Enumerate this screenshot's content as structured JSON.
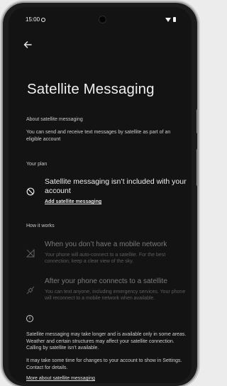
{
  "status_bar": {
    "time": "15:00"
  },
  "page": {
    "title": "Satellite Messaging"
  },
  "about": {
    "heading": "About satellite messaging",
    "text": "You can send and receive text messages by satellite as part of an eligible  account"
  },
  "plan": {
    "heading": "Your plan",
    "title": "Satellite messaging isn’t included with your account",
    "link": "Add satellite messaging"
  },
  "how": {
    "heading": "How it works",
    "items": [
      {
        "title": "When you don’t have a mobile network",
        "desc": "Your phone will auto-connect to a satellite. For the best connection, keep a clear view of the sky."
      },
      {
        "title": "After your phone connects to a satellite",
        "desc": "You can text anyone, including emergency services. Your phone will reconnect to a mobile network when available."
      }
    ]
  },
  "notes": {
    "para1": "Satellite messaging may take longer and is available only in some areas. Weather and certain structures may affect your satellite connection. Calling by satellite isn’t available.",
    "para2": "It may take some time for changes to your account to show in Settings. Contact  for details.",
    "link": "More about satellite messaging"
  }
}
